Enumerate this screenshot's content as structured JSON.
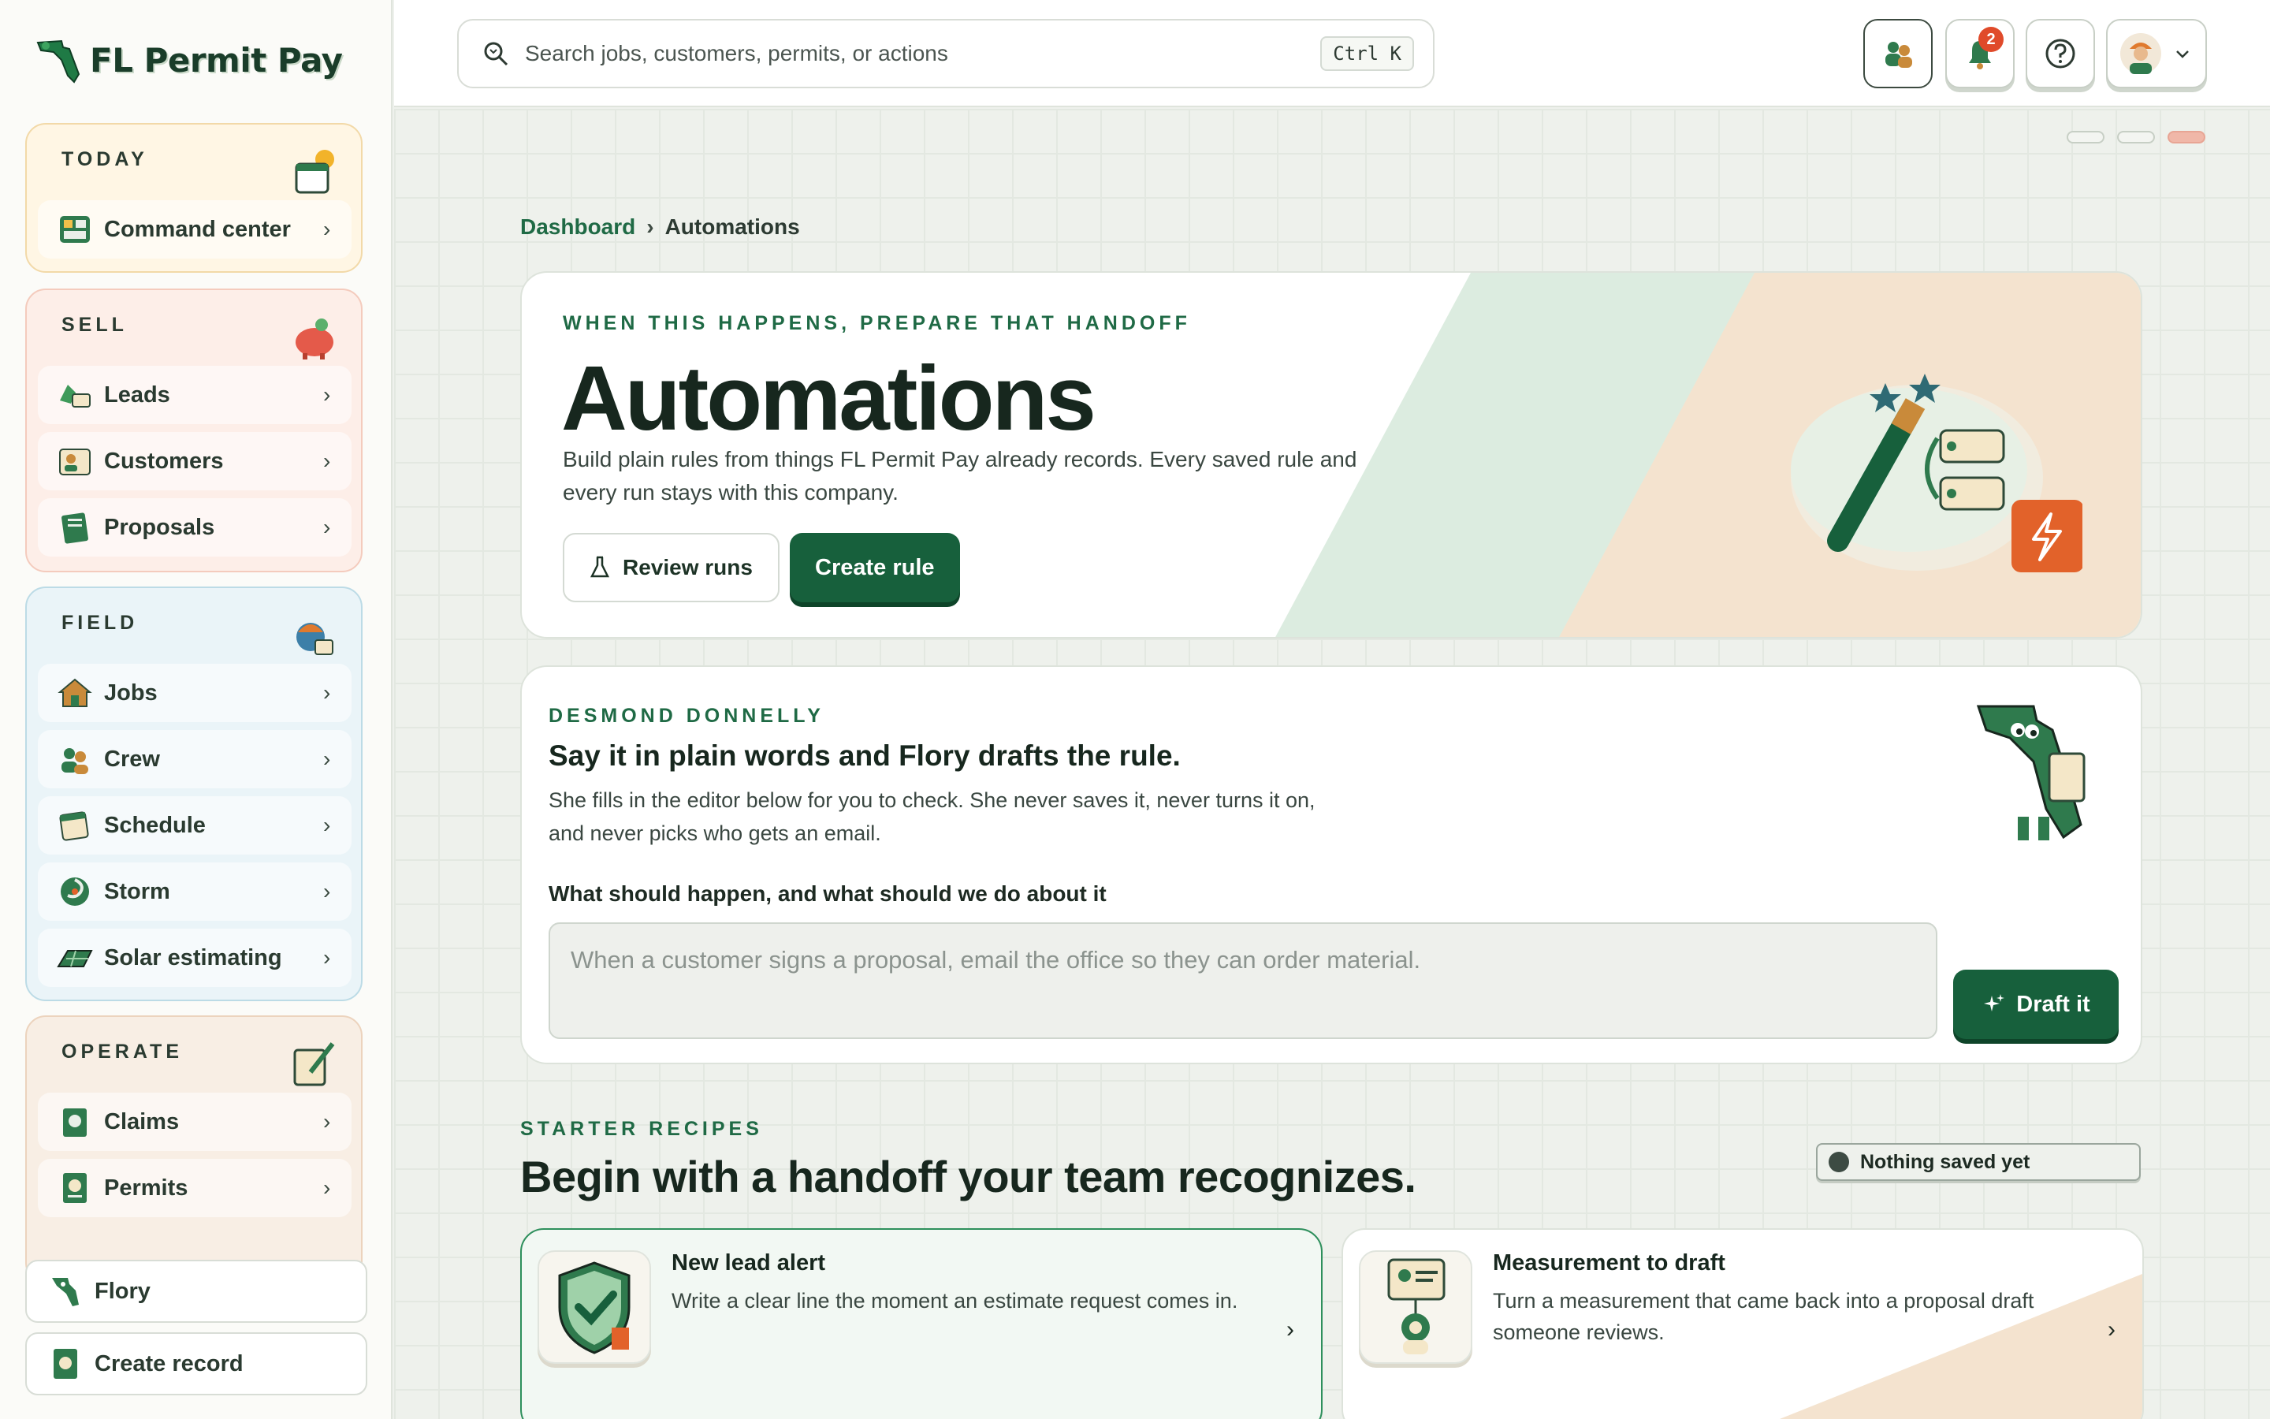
{
  "app": {
    "name": "FL Permit Pay"
  },
  "sidebar": {
    "groups": [
      {
        "title": "TODAY",
        "items": [
          {
            "label": "Command center"
          }
        ]
      },
      {
        "title": "SELL",
        "items": [
          {
            "label": "Leads"
          },
          {
            "label": "Customers"
          },
          {
            "label": "Proposals"
          }
        ]
      },
      {
        "title": "FIELD",
        "items": [
          {
            "label": "Jobs"
          },
          {
            "label": "Crew"
          },
          {
            "label": "Schedule"
          },
          {
            "label": "Storm"
          },
          {
            "label": "Solar estimating"
          }
        ]
      },
      {
        "title": "OPERATE",
        "items": [
          {
            "label": "Claims"
          },
          {
            "label": "Permits"
          }
        ]
      }
    ],
    "bottom": {
      "flory_label": "Flory",
      "create_label": "Create record"
    }
  },
  "topbar": {
    "search_placeholder": "Search jobs, customers, permits, or actions",
    "shortcut": "Ctrl K",
    "notification_count": "2"
  },
  "breadcrumb": {
    "parent": "Dashboard",
    "separator": "›",
    "current": "Automations"
  },
  "hero": {
    "eyebrow": "WHEN THIS HAPPENS, PREPARE THAT HANDOFF",
    "title": "Automations",
    "description": "Build plain rules from things FL Permit Pay already records. Every saved rule and every run stays with this company.",
    "review_label": "Review runs",
    "create_label": "Create rule"
  },
  "flory": {
    "eyebrow": "DESMOND DONNELLY",
    "title": "Say it in plain words and Flory drafts the rule.",
    "description": "She fills in the editor below for you to check. She never saves it, never turns it on, and never picks who gets an email.",
    "field_label": "What should happen, and what should we do about it",
    "placeholder": "When a customer signs a proposal, email the office so they can order material.",
    "draft_label": "Draft it"
  },
  "recipes": {
    "eyebrow": "STARTER RECIPES",
    "title": "Begin with a handoff your team recognizes.",
    "status": "Nothing saved yet",
    "cards": [
      {
        "title": "New lead alert",
        "description": "Write a clear line the moment an estimate request comes in."
      },
      {
        "title": "Measurement to draft",
        "description": "Turn a measurement that came back into a proposal draft someone reviews."
      }
    ]
  },
  "colors": {
    "brand_green": "#17603c",
    "accent_orange": "#e2622a",
    "badge_red": "#e04a2a"
  },
  "icons": {
    "search": "search-icon",
    "notifications": "bell-icon",
    "help": "help-icon",
    "chevron": "chevron-right-icon",
    "flask": "flask-icon",
    "sparkle": "sparkle-icon",
    "lightning": "lightning-icon"
  }
}
